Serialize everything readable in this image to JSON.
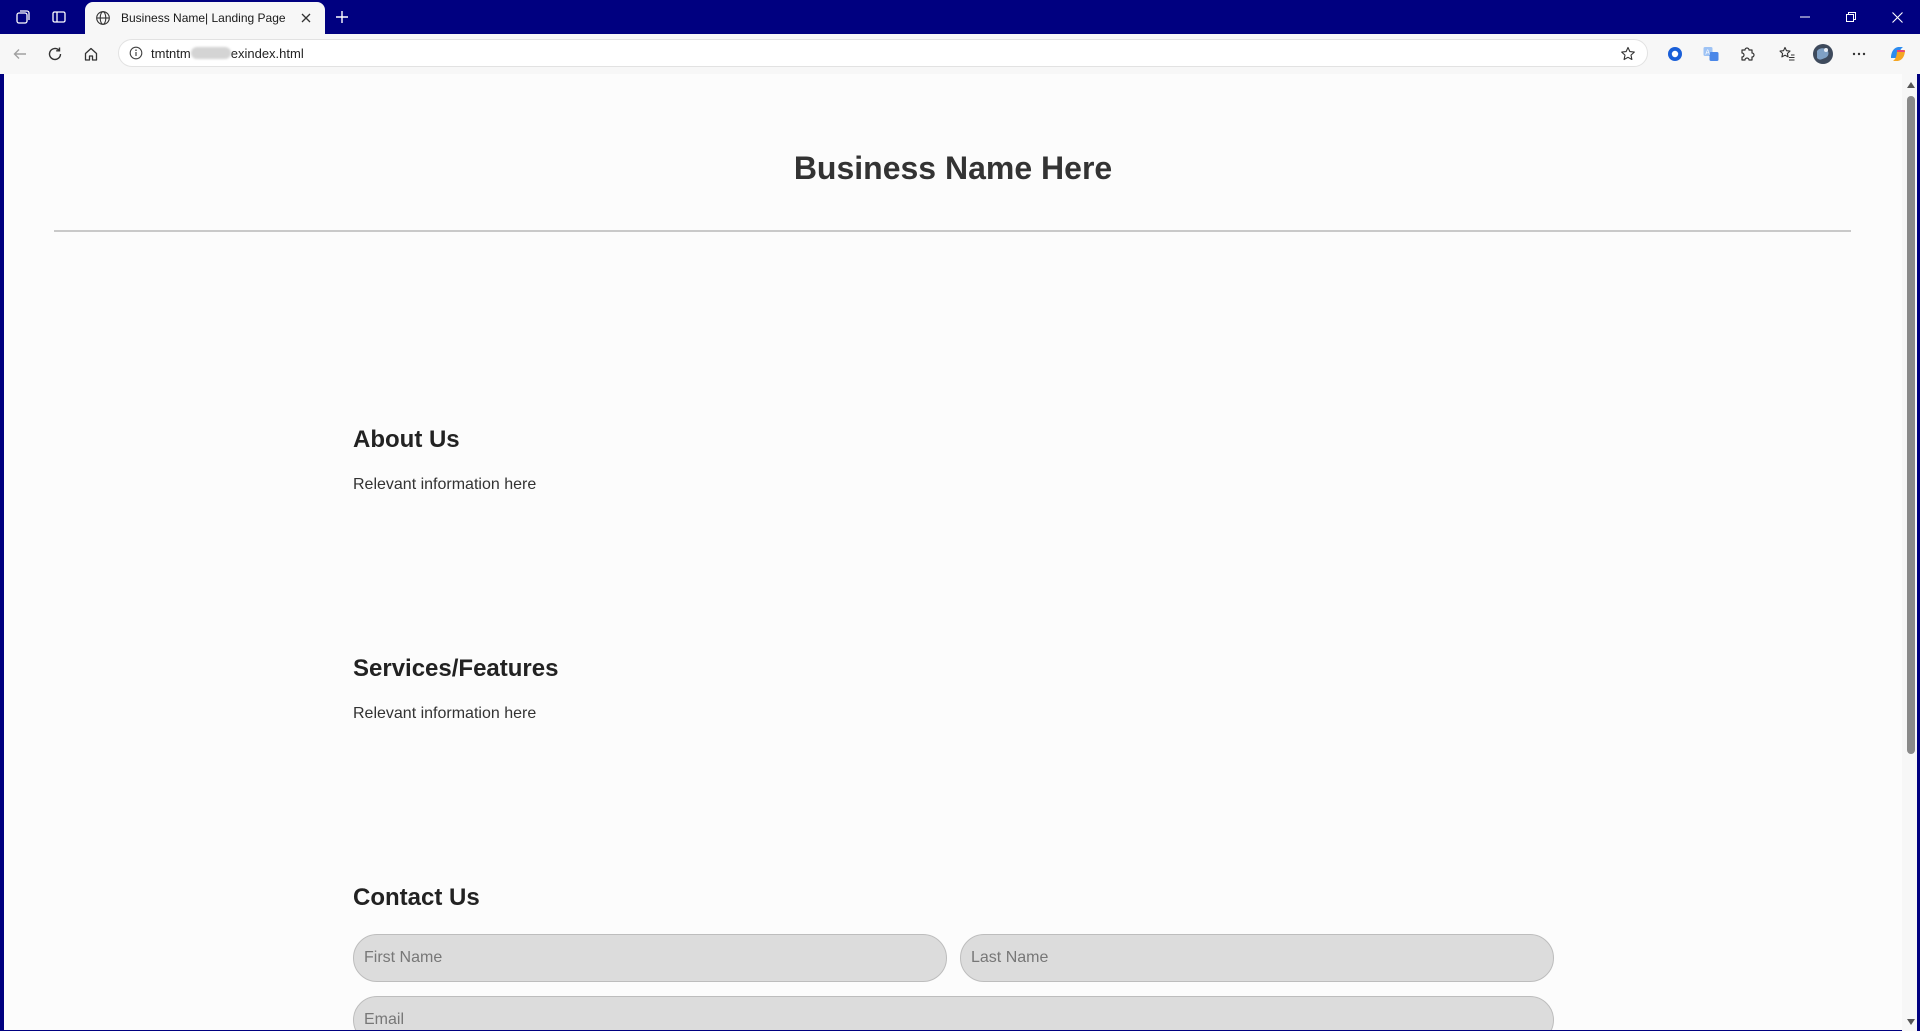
{
  "browser": {
    "tab_title": "Business Name| Landing Page",
    "url_prefix": "tmtntm",
    "url_suffix": "exindex.html"
  },
  "icons": {
    "workspaces": "workspaces-icon",
    "tab_actions": "tab-actions-icon",
    "tab_favicon": "globe-icon",
    "tab_close": "close-icon",
    "new_tab": "plus-icon",
    "minimize": "minimize-icon",
    "restore": "restore-icon",
    "close_window": "close-icon",
    "back": "back-arrow-icon",
    "refresh": "refresh-icon",
    "home": "home-icon",
    "site_info": "info-icon",
    "favorite": "star-icon",
    "extension_1": "circle-extension-icon",
    "translate": "translate-icon",
    "extensions": "puzzle-icon",
    "favorites": "favorites-icon",
    "profile": "avatar",
    "more": "more-icon",
    "copilot": "copilot-icon"
  },
  "page": {
    "title": "Business Name Here",
    "about": {
      "heading": "About Us",
      "body": "Relevant information here"
    },
    "services": {
      "heading": "Services/Features",
      "body": "Relevant information here"
    },
    "contact": {
      "heading": "Contact Us",
      "first_name_placeholder": "First Name",
      "last_name_placeholder": "Last Name",
      "email_placeholder": "Email"
    }
  },
  "colors": {
    "titlebar": "#000080",
    "page_background": "#fcfcfc",
    "input_fill": "#dcdcdc"
  }
}
